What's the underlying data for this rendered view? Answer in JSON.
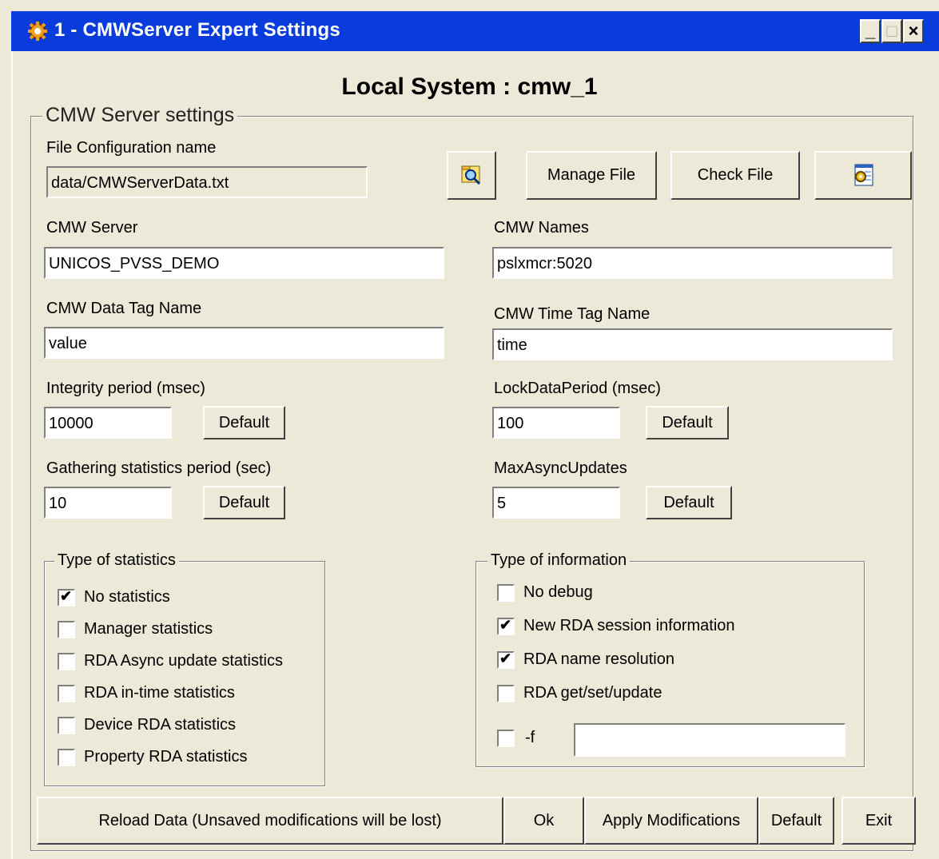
{
  "window": {
    "title": "1 - CMWServer Expert Settings",
    "minimize_glyph": "_",
    "maximize_glyph": "□",
    "close_glyph": "×"
  },
  "local_system_title": "Local System : cmw_1",
  "server_settings": {
    "group_label": "CMW Server settings",
    "file_config_label": "File Configuration name",
    "file_config_value": "data/CMWServerData.txt",
    "manage_file_label": "Manage File",
    "check_file_label": "Check File",
    "cmw_server_label": "CMW Server",
    "cmw_server_value": "UNICOS_PVSS_DEMO",
    "cmw_names_label": "CMW Names",
    "cmw_names_value": "pslxmcr:5020",
    "data_tag_label": "CMW Data Tag Name",
    "data_tag_value": "value",
    "time_tag_label": "CMW Time Tag Name",
    "time_tag_value": "time",
    "integrity_label": "Integrity period (msec)",
    "integrity_value": "10000",
    "lockdata_label": "LockDataPeriod (msec)",
    "lockdata_value": "100",
    "gathering_label": "Gathering statistics period (sec)",
    "gathering_value": "10",
    "maxasync_label": "MaxAsyncUpdates",
    "maxasync_value": "5",
    "default_label": "Default"
  },
  "statistics": {
    "group_label": "Type of statistics",
    "items": [
      {
        "label": "No statistics",
        "checked": true
      },
      {
        "label": "Manager statistics",
        "checked": false
      },
      {
        "label": "RDA Async update statistics",
        "checked": false
      },
      {
        "label": "RDA in-time statistics",
        "checked": false
      },
      {
        "label": "Device RDA statistics",
        "checked": false
      },
      {
        "label": "Property RDA statistics",
        "checked": false
      }
    ]
  },
  "information": {
    "group_label": "Type of information",
    "items": [
      {
        "label": "No debug",
        "checked": false
      },
      {
        "label": "New RDA session information",
        "checked": true
      },
      {
        "label": "RDA name resolution",
        "checked": true
      },
      {
        "label": "RDA get/set/update",
        "checked": false
      },
      {
        "label": "-f",
        "checked": false
      }
    ],
    "f_value": ""
  },
  "footer": {
    "reload_label": "Reload Data (Unsaved modifications will be lost)",
    "ok_label": "Ok",
    "apply_label": "Apply Modifications",
    "default_label": "Default",
    "exit_label": "Exit"
  },
  "icons": {
    "app": "gear-icon",
    "browse": "folder-search-icon",
    "config": "settings-window-icon"
  },
  "colors": {
    "titlebar": "#0a3cdc",
    "background": "#ece9d8"
  }
}
